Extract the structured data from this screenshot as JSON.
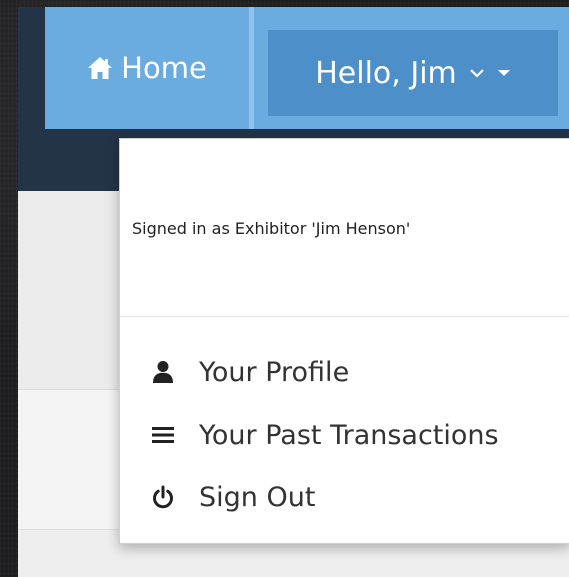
{
  "navbar": {
    "home_label": "Home",
    "home_icon": "home-icon",
    "user_greeting": "Hello, Jim",
    "chevron_icon": "chevron-down-icon",
    "caret_icon": "caret-down-icon"
  },
  "dropdown": {
    "signed_in_text": "Signed in as Exhibitor 'Jim Henson'",
    "items": [
      {
        "label": "Your Profile",
        "icon": "user-icon"
      },
      {
        "label": "Your Past Transactions",
        "icon": "list-icon"
      },
      {
        "label": "Sign Out",
        "icon": "power-icon"
      }
    ]
  },
  "colors": {
    "navbar_dark": "#233448",
    "nav_button": "#6aabe0",
    "nav_button_active": "#4c8fc9",
    "text_dark": "#333333"
  }
}
